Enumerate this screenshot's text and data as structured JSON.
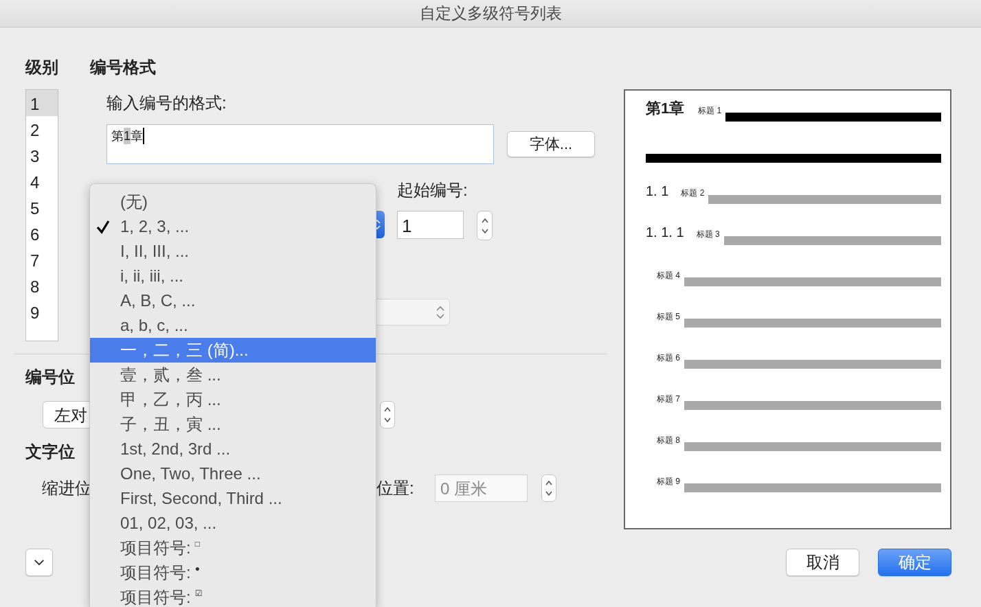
{
  "window": {
    "title": "自定义多级符号列表"
  },
  "headers": {
    "level": "级别",
    "format": "编号格式"
  },
  "levels": [
    {
      "label": "1",
      "selected": true
    },
    {
      "label": "2",
      "selected": false
    },
    {
      "label": "3",
      "selected": false
    },
    {
      "label": "4",
      "selected": false
    },
    {
      "label": "5",
      "selected": false
    },
    {
      "label": "6",
      "selected": false
    },
    {
      "label": "7",
      "selected": false
    },
    {
      "label": "8",
      "selected": false
    },
    {
      "label": "9",
      "selected": false
    }
  ],
  "format_label": "输入编号的格式:",
  "format_field": {
    "prefix": "第",
    "number": "1",
    "suffix": "章"
  },
  "font_button": "字体...",
  "start_label": "起始编号:",
  "start_field": {
    "value": "1"
  },
  "position_header": "编号位",
  "align_popup": "左对",
  "text_position_header": "文字位",
  "indent_label": "缩进位",
  "tab_label": "位置:",
  "tab_field": {
    "value": "0 厘米",
    "disabled": true
  },
  "preview": {
    "items": [
      {
        "number": "第1章",
        "label": "标题 1",
        "highlighted": true
      },
      {
        "number": "1. 1",
        "label": "标题 2",
        "highlighted": false
      },
      {
        "number": "1. 1. 1",
        "label": "标题 3",
        "highlighted": false
      },
      {
        "label": "标题 4",
        "highlighted": false
      },
      {
        "label": "标题 5",
        "highlighted": false
      },
      {
        "label": "标题 6",
        "highlighted": false
      },
      {
        "label": "标题 7",
        "highlighted": false
      },
      {
        "label": "标题 8",
        "highlighted": false
      },
      {
        "label": "标题 9",
        "highlighted": false
      }
    ]
  },
  "buttons": [
    {
      "label": "取消",
      "kind": "cancel"
    },
    {
      "label": "确定",
      "kind": "default"
    }
  ],
  "menu": [
    {
      "label": "(无)",
      "checked": false,
      "selected": false
    },
    {
      "label": "1, 2, 3, ...",
      "checked": true,
      "selected": false
    },
    {
      "label": "I, II, III, ...",
      "checked": false,
      "selected": false
    },
    {
      "label": "i, ii, iii, ...",
      "checked": false,
      "selected": false
    },
    {
      "label": "A, B, C, ...",
      "checked": false,
      "selected": false
    },
    {
      "label": "a, b, c, ...",
      "checked": false,
      "selected": false
    },
    {
      "label": "一，二，三 (简)...",
      "checked": false,
      "selected": true
    },
    {
      "label": "壹，贰，叁 ...",
      "checked": false,
      "selected": false
    },
    {
      "label": "甲，乙，丙 ...",
      "checked": false,
      "selected": false
    },
    {
      "label": "子，丑，寅 ...",
      "checked": false,
      "selected": false
    },
    {
      "label": "1st, 2nd, 3rd ...",
      "checked": false,
      "selected": false
    },
    {
      "label": "One, Two, Three ...",
      "checked": false,
      "selected": false
    },
    {
      "label": "First, Second, Third ...",
      "checked": false,
      "selected": false
    },
    {
      "label": "01, 02, 03, ...",
      "checked": false,
      "selected": false
    },
    {
      "label": "项目符号:",
      "symbol": "□",
      "checked": false,
      "selected": false
    },
    {
      "label": "项目符号:",
      "symbol": "●",
      "checked": false,
      "selected": false
    },
    {
      "label": "项目符号:",
      "symbol": "☑",
      "checked": false,
      "selected": false
    }
  ]
}
